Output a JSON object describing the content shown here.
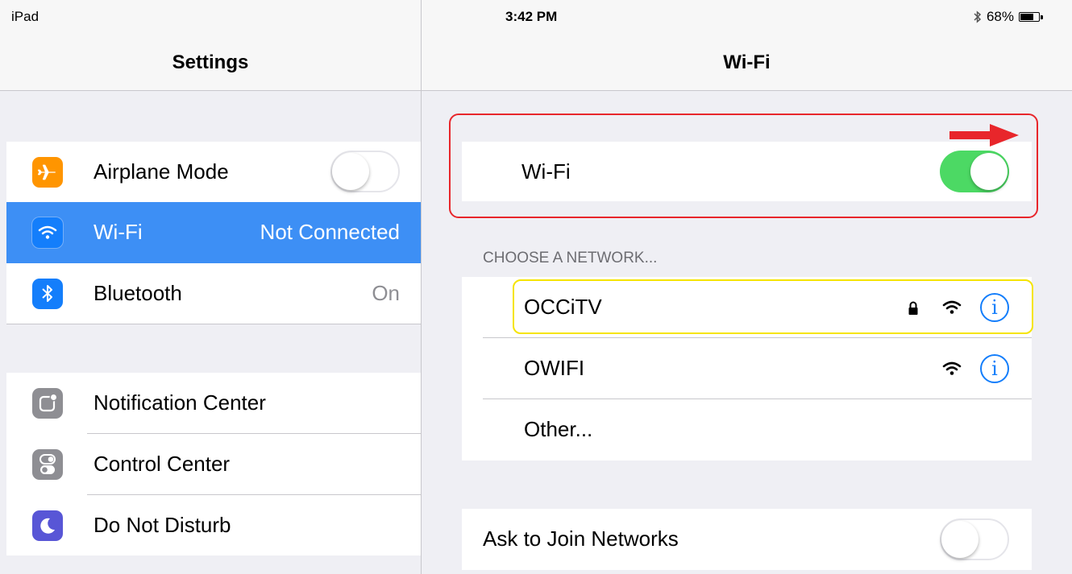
{
  "status_bar": {
    "device": "iPad",
    "time": "3:42 PM",
    "battery": "68%",
    "battery_level": 0.68
  },
  "left_pane": {
    "title": "Settings",
    "group1": [
      {
        "label": "Airplane Mode",
        "icon": "airplane-icon",
        "icon_color": "#ff9500",
        "toggle": "off"
      },
      {
        "label": "Wi-Fi",
        "value": "Not Connected",
        "icon": "wifi-icon",
        "icon_color": "#147efb",
        "selected": true
      },
      {
        "label": "Bluetooth",
        "value": "On",
        "icon": "bluetooth-icon",
        "icon_color": "#147efb"
      }
    ],
    "group2": [
      {
        "label": "Notification Center",
        "icon": "notification-center-icon",
        "icon_color": "#8e8e93"
      },
      {
        "label": "Control Center",
        "icon": "control-center-icon",
        "icon_color": "#8e8e93"
      },
      {
        "label": "Do Not Disturb",
        "icon": "moon-icon",
        "icon_color": "#5856d6"
      }
    ]
  },
  "right_pane": {
    "title": "Wi-Fi",
    "wifi_row": {
      "label": "Wi-Fi",
      "toggle": "on"
    },
    "section_header": "CHOOSE A NETWORK...",
    "networks": [
      {
        "name": "OCCiTV",
        "secured": true
      },
      {
        "name": "OWIFI",
        "secured": false
      }
    ],
    "other_label": "Other...",
    "ask_to_join": {
      "label": "Ask to Join Networks",
      "toggle": "off"
    }
  },
  "colors": {
    "accent": "#147efb",
    "selected_row": "#3d8ff5",
    "toggle_on": "#4cd964",
    "annotation_red": "#e8262b",
    "annotation_yellow": "#f5e400"
  }
}
